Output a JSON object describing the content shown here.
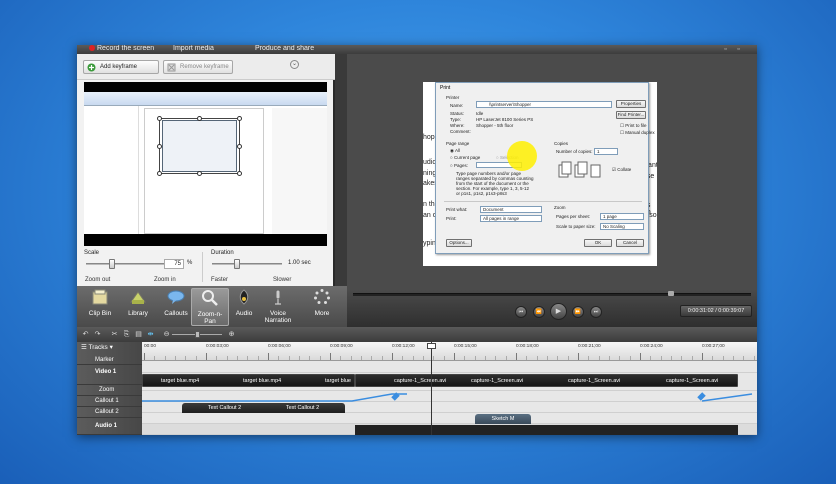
{
  "topbar": {
    "record": "Record the screen",
    "import": "Import media",
    "produce": "Produce and share",
    "dims": "",
    "title": ""
  },
  "left_panel": {
    "add_keyframe": "Add keyframe",
    "remove_keyframe": "Remove keyframe",
    "scale_label": "Scale",
    "scale_value": "75",
    "scale_unit": "%",
    "zoom_out": "Zoom out",
    "zoom_in": "Zoom in",
    "duration_label": "Duration",
    "duration_value": "1.00",
    "duration_unit": "sec",
    "faster": "Faster",
    "slower": "Slower",
    "scale_level": 0.3,
    "duration_level": 0.35
  },
  "tools": [
    {
      "label": "Clip Bin",
      "icon": "clip-bin-icon"
    },
    {
      "label": "Library",
      "icon": "library-icon"
    },
    {
      "label": "Callouts",
      "icon": "callouts-icon"
    },
    {
      "label": "Zoom-n-Pan",
      "icon": "zoom-n-pan-icon"
    },
    {
      "label": "Audio",
      "icon": "audio-icon"
    },
    {
      "label": "Voice Narration",
      "icon": "voice-narration-icon"
    },
    {
      "label": "More",
      "icon": "more-icon"
    }
  ],
  "canvas": {
    "doc_snippets": [
      "hop.t",
      "udio a",
      "ning o",
      "akes t",
      "n the",
      "an ch",
      "yping"
    ],
    "doc_snippets_right": [
      "want",
      "nse s",
      "gs an",
      "resol"
    ],
    "print_dialog": {
      "title": "Print",
      "printer": "Printer",
      "name_label": "Name:",
      "name_value": "\\\\printserver\\Shopper",
      "properties": "Properties",
      "find_printer": "Find Printer...",
      "status_label": "Status:",
      "status_value": "Idle",
      "type_label": "Type:",
      "type_value": "HP LaserJet 8100 Series PS",
      "where_label": "Where:",
      "where_value": "Shopper - 5th floor",
      "comment_label": "Comment:",
      "print_to_file": "Print to file",
      "manual_duplex": "Manual duplex",
      "page_range": "Page range",
      "all": "All",
      "current_page": "Current page",
      "selection": "Selection",
      "pages": "Pages:",
      "pages_help_1": "Type page numbers and/or page",
      "pages_help_2": "ranges separated by commas counting",
      "pages_help_3": "from the start of the document or the",
      "pages_help_4": "section. For example, type 1, 3, 5-12",
      "pages_help_5": "or p1s1, p1s2, p1s3-p8s3",
      "copies": "Copies",
      "num_copies": "Number of copies:",
      "num_copies_value": "1",
      "collate": "Collate",
      "print_what_label": "Print what:",
      "print_what_value": "Document",
      "print_label": "Print:",
      "print_value": "All pages in range",
      "zoom": "Zoom",
      "pages_per_sheet_label": "Pages per sheet:",
      "pages_per_sheet_value": "1 page",
      "scale_to_paper_label": "Scale to paper size:",
      "scale_to_paper_value": "No Scaling",
      "options": "Options...",
      "ok": "OK",
      "cancel": "Cancel"
    }
  },
  "player": {
    "time": "0:00:31:02 / 0:00:39:07",
    "position": 0.8
  },
  "timeline": {
    "tracks_label": "Tracks",
    "rows": [
      "Marker",
      "Video 1",
      "Zoom",
      "Callout 1",
      "Callout 2",
      "Audio 1"
    ],
    "ticks": [
      "00:00",
      "0:00:03;00",
      "0:00:06;00",
      "0:00:09;00",
      "0:00:12;00",
      "0:00:15;00",
      "0:00:18;00",
      "0:00:21;00",
      "0:00:24;00",
      "0:00:27;00"
    ],
    "clips": [
      {
        "label": "target blue.mp4"
      },
      {
        "label": "target blue.mp4"
      },
      {
        "label": "target blue"
      },
      {
        "label": "capture-1_Screen.avi"
      },
      {
        "label": "capture-1_Screen.avi"
      },
      {
        "label": "capture-1_Screen.avi"
      },
      {
        "label": "capture-1_Screen.avi"
      }
    ],
    "callouts": [
      "Text Callout 2",
      "Text Callout 2"
    ],
    "callout2": "Sketch M"
  }
}
